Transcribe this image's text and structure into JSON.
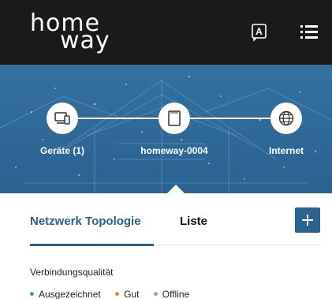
{
  "header": {
    "logo_line1": "home",
    "logo_line2": "way",
    "language_icon": "language-a-icon",
    "menu_icon": "hamburger-menu-icon"
  },
  "topology": {
    "nodes": [
      {
        "label": "Geräte (1)",
        "icon": "devices-icon"
      },
      {
        "label": "homeway-0004",
        "icon": "router-icon"
      },
      {
        "label": "Internet",
        "icon": "globe-icon"
      }
    ]
  },
  "tabs": {
    "items": [
      {
        "label": "Netzwerk Topologie",
        "active": true
      },
      {
        "label": "Liste",
        "active": false
      }
    ],
    "add_icon": "plus-icon"
  },
  "quality": {
    "title": "Verbindungsqualität",
    "legend": [
      {
        "label": "Ausgezeichnet",
        "color": "#2db84d"
      },
      {
        "label": "Gut",
        "color": "#f08a24"
      },
      {
        "label": "Offline",
        "color": "#a0a0a0"
      }
    ]
  },
  "colors": {
    "header_bg": "#1a1a1a",
    "hero_bg": "#2e6897",
    "accent": "#2a6290"
  }
}
